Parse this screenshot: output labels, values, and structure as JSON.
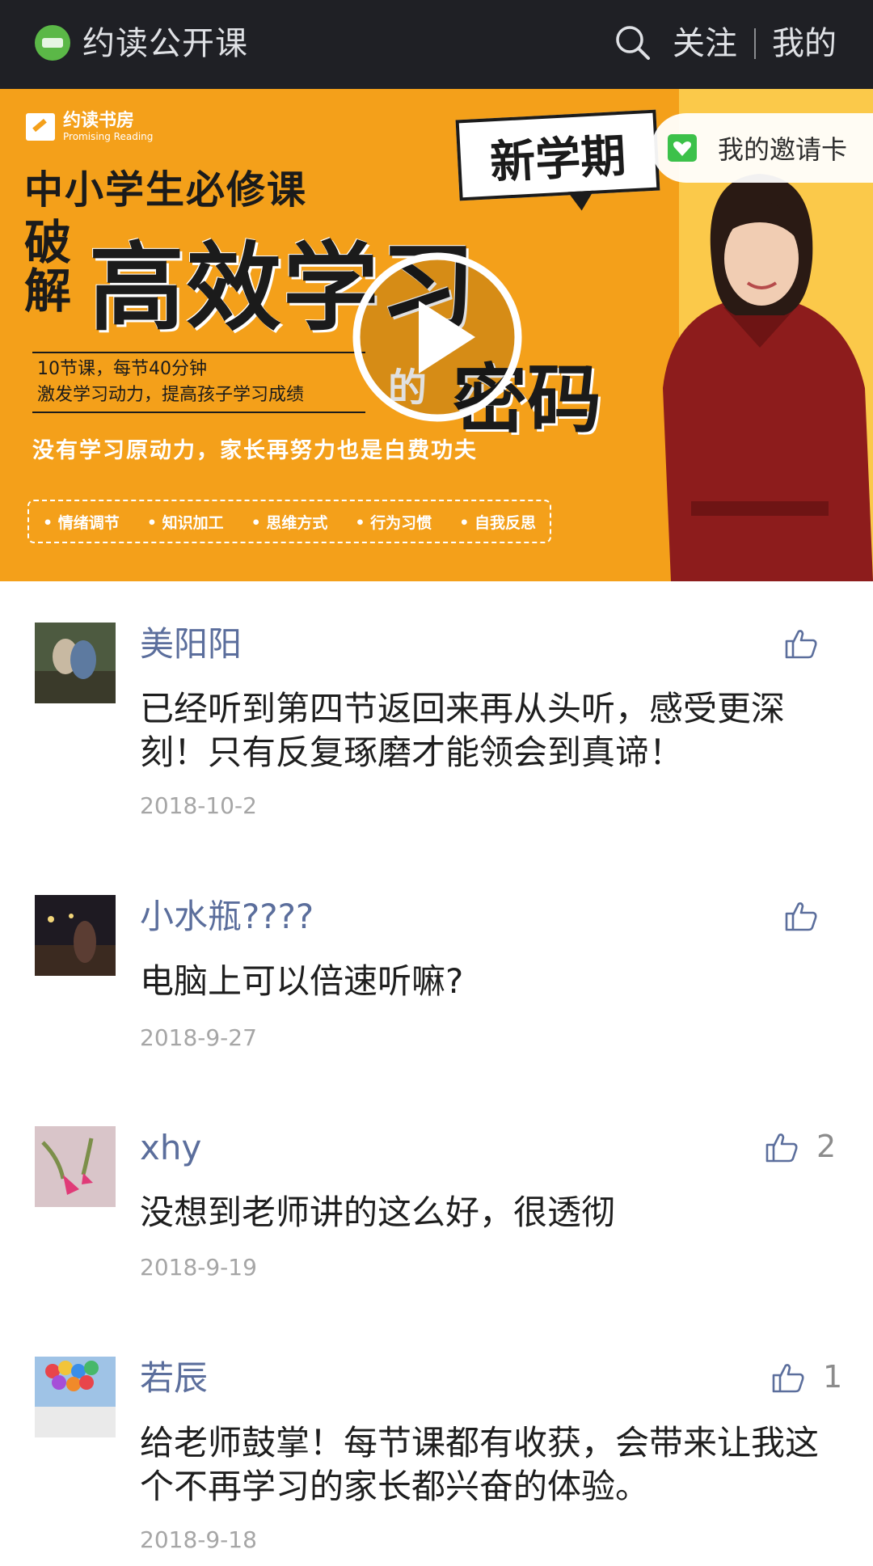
{
  "header": {
    "app_title": "约读公开课",
    "follow_label": "关注",
    "mine_label": "我的"
  },
  "banner": {
    "brand_cn": "约读书房",
    "brand_en": "Promising Reading",
    "kicker": "中小学生必修课",
    "po_jie": "破解",
    "big_title": "高效学习",
    "de_char": "的",
    "mima": "密码",
    "promo_line1": "10节课，每节40分钟",
    "promo_line2": "激发学习动力，提高孩子学习成绩",
    "tagline": "没有学习原动力，家长再努力也是白费功夫",
    "features": [
      "• 情绪调节",
      "• 知识加工",
      "• 思维方式",
      "• 行为习惯",
      "• 自我反思"
    ],
    "speech_bubble": "新学期",
    "invite_label": "我的邀请卡"
  },
  "comments": [
    {
      "username": "美阳阳",
      "text": "已经听到第四节返回来再从头听，感受更深刻！只有反复琢磨才能领会到真谛！",
      "date": "2018-10-2",
      "likes": ""
    },
    {
      "username": "小水瓶????",
      "text": "电脑上可以倍速听嘛?",
      "date": "2018-9-27",
      "likes": ""
    },
    {
      "username": "xhy",
      "text": "没想到老师讲的这么好，很透彻",
      "date": "2018-9-19",
      "likes": "2"
    },
    {
      "username": "若辰",
      "text": "给老师鼓掌！每节课都有收获，会带来让我这个不再学习的家长都兴奋的体验。",
      "date": "2018-9-18",
      "likes": "1"
    }
  ],
  "colors": {
    "header_bg": "#1f2025",
    "banner_orange": "#f4a01a",
    "username_blue": "#5b6e9c",
    "date_gray": "#a6a6a6",
    "invite_green": "#3cc14a"
  },
  "icons": [
    "logo-icon",
    "search-icon",
    "play-icon",
    "heart-card-icon",
    "thumbs-up-icon"
  ]
}
